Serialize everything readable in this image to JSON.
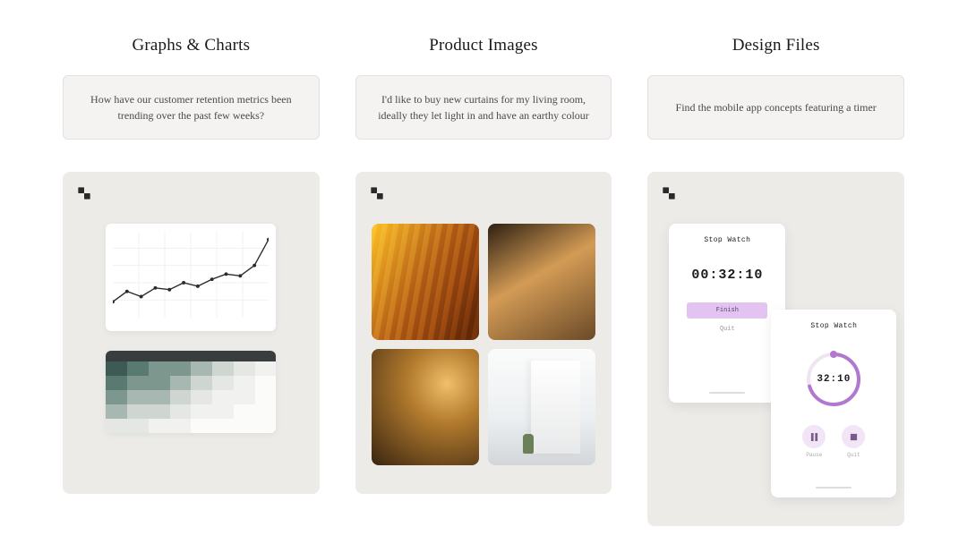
{
  "columns": [
    {
      "title": "Graphs & Charts",
      "prompt": "How have our customer retention metrics been trending over the past few weeks?"
    },
    {
      "title": "Product Images",
      "prompt": "I'd like to buy new curtains for my living room, ideally they let light in and have an earthy colour"
    },
    {
      "title": "Design Files",
      "prompt": "Find the mobile app concepts featuring a timer"
    }
  ],
  "stopwatch_a": {
    "title": "Stop Watch",
    "time": "00:32:10",
    "primary_button": "Finish",
    "secondary_button": "Quit"
  },
  "stopwatch_b": {
    "title": "Stop Watch",
    "time": "32:10",
    "left_button": "Pause",
    "right_button": "Quit"
  },
  "chart_data": [
    {
      "type": "line",
      "x": [
        0,
        1,
        2,
        3,
        4,
        5,
        6,
        7,
        8,
        9,
        10,
        11
      ],
      "values": [
        18,
        30,
        24,
        34,
        32,
        40,
        36,
        44,
        50,
        48,
        60,
        90
      ],
      "ylim": [
        0,
        100
      ],
      "title": "",
      "xlabel": "",
      "ylabel": ""
    },
    {
      "type": "heatmap",
      "rows": 5,
      "cols": 8,
      "palette": [
        "#3e5a54",
        "#597a71",
        "#7d978f",
        "#a7b8b2",
        "#cfd6d2",
        "#e4e7e4",
        "#f1f2f0",
        "#fbfbfa"
      ],
      "cells": [
        [
          0,
          1,
          2,
          2,
          3,
          4,
          5,
          6
        ],
        [
          1,
          2,
          2,
          3,
          4,
          5,
          6,
          7
        ],
        [
          2,
          3,
          3,
          4,
          5,
          6,
          6,
          7
        ],
        [
          3,
          4,
          4,
          5,
          6,
          6,
          7,
          7
        ],
        [
          5,
          5,
          6,
          6,
          7,
          7,
          7,
          7
        ]
      ]
    }
  ]
}
